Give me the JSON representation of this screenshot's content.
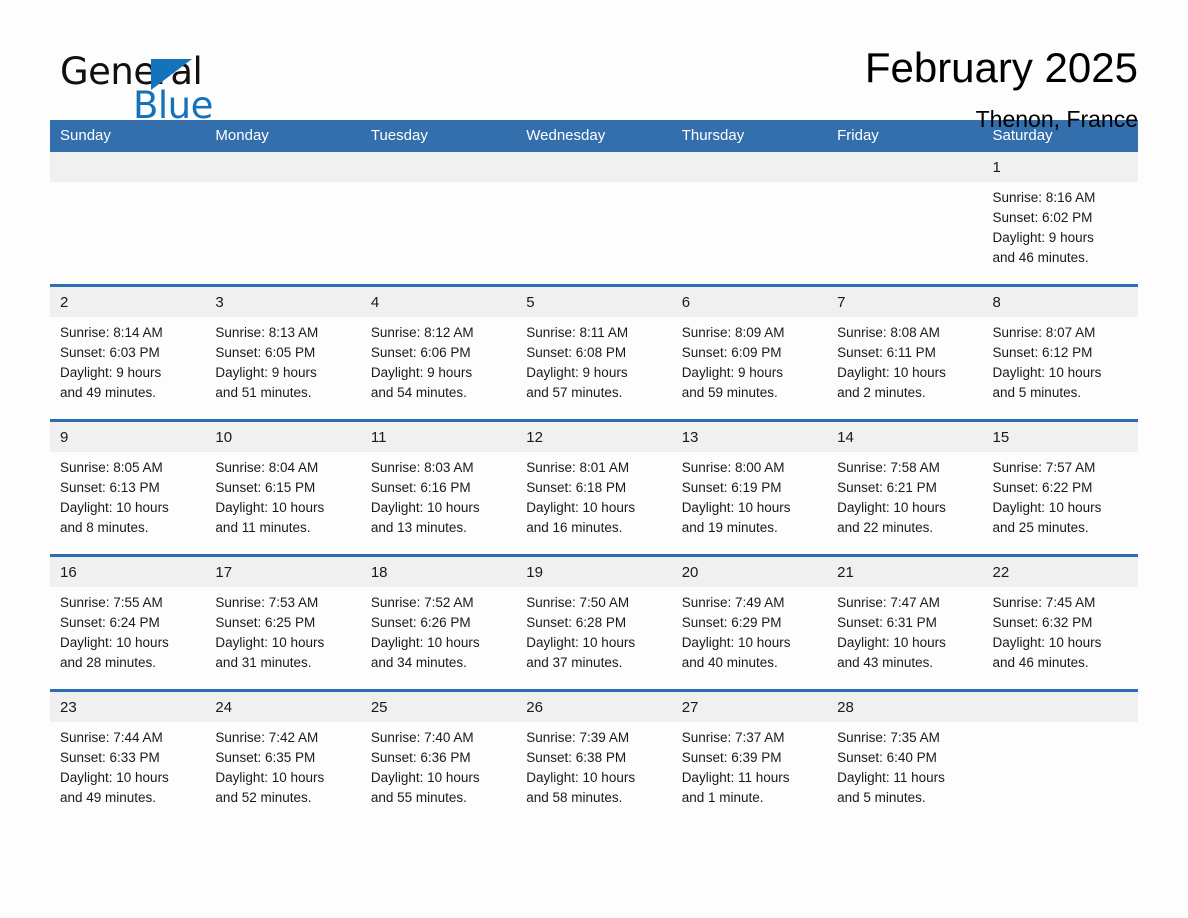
{
  "logo": {
    "word_one": "General",
    "word_two": "Blue",
    "triangle_color": "#1372ba",
    "icon": "triangle-icon"
  },
  "header": {
    "title": "February 2025",
    "location": "Thenon, France"
  },
  "theme": {
    "header_blue": "#336ead",
    "divider_blue": "#2b6cb2",
    "daynum_band": "#f0f0f0",
    "page_background": "#fdfdfd",
    "text": "#1a1a1a"
  },
  "calendar": {
    "weekday_headers": [
      "Sunday",
      "Monday",
      "Tuesday",
      "Wednesday",
      "Thursday",
      "Friday",
      "Saturday"
    ],
    "weeks": [
      [
        {
          "day": "",
          "lines": []
        },
        {
          "day": "",
          "lines": []
        },
        {
          "day": "",
          "lines": []
        },
        {
          "day": "",
          "lines": []
        },
        {
          "day": "",
          "lines": []
        },
        {
          "day": "",
          "lines": []
        },
        {
          "day": "1",
          "lines": [
            "Sunrise: 8:16 AM",
            "Sunset: 6:02 PM",
            "Daylight: 9 hours",
            "and 46 minutes."
          ]
        }
      ],
      [
        {
          "day": "2",
          "lines": [
            "Sunrise: 8:14 AM",
            "Sunset: 6:03 PM",
            "Daylight: 9 hours",
            "and 49 minutes."
          ]
        },
        {
          "day": "3",
          "lines": [
            "Sunrise: 8:13 AM",
            "Sunset: 6:05 PM",
            "Daylight: 9 hours",
            "and 51 minutes."
          ]
        },
        {
          "day": "4",
          "lines": [
            "Sunrise: 8:12 AM",
            "Sunset: 6:06 PM",
            "Daylight: 9 hours",
            "and 54 minutes."
          ]
        },
        {
          "day": "5",
          "lines": [
            "Sunrise: 8:11 AM",
            "Sunset: 6:08 PM",
            "Daylight: 9 hours",
            "and 57 minutes."
          ]
        },
        {
          "day": "6",
          "lines": [
            "Sunrise: 8:09 AM",
            "Sunset: 6:09 PM",
            "Daylight: 9 hours",
            "and 59 minutes."
          ]
        },
        {
          "day": "7",
          "lines": [
            "Sunrise: 8:08 AM",
            "Sunset: 6:11 PM",
            "Daylight: 10 hours",
            "and 2 minutes."
          ]
        },
        {
          "day": "8",
          "lines": [
            "Sunrise: 8:07 AM",
            "Sunset: 6:12 PM",
            "Daylight: 10 hours",
            "and 5 minutes."
          ]
        }
      ],
      [
        {
          "day": "9",
          "lines": [
            "Sunrise: 8:05 AM",
            "Sunset: 6:13 PM",
            "Daylight: 10 hours",
            "and 8 minutes."
          ]
        },
        {
          "day": "10",
          "lines": [
            "Sunrise: 8:04 AM",
            "Sunset: 6:15 PM",
            "Daylight: 10 hours",
            "and 11 minutes."
          ]
        },
        {
          "day": "11",
          "lines": [
            "Sunrise: 8:03 AM",
            "Sunset: 6:16 PM",
            "Daylight: 10 hours",
            "and 13 minutes."
          ]
        },
        {
          "day": "12",
          "lines": [
            "Sunrise: 8:01 AM",
            "Sunset: 6:18 PM",
            "Daylight: 10 hours",
            "and 16 minutes."
          ]
        },
        {
          "day": "13",
          "lines": [
            "Sunrise: 8:00 AM",
            "Sunset: 6:19 PM",
            "Daylight: 10 hours",
            "and 19 minutes."
          ]
        },
        {
          "day": "14",
          "lines": [
            "Sunrise: 7:58 AM",
            "Sunset: 6:21 PM",
            "Daylight: 10 hours",
            "and 22 minutes."
          ]
        },
        {
          "day": "15",
          "lines": [
            "Sunrise: 7:57 AM",
            "Sunset: 6:22 PM",
            "Daylight: 10 hours",
            "and 25 minutes."
          ]
        }
      ],
      [
        {
          "day": "16",
          "lines": [
            "Sunrise: 7:55 AM",
            "Sunset: 6:24 PM",
            "Daylight: 10 hours",
            "and 28 minutes."
          ]
        },
        {
          "day": "17",
          "lines": [
            "Sunrise: 7:53 AM",
            "Sunset: 6:25 PM",
            "Daylight: 10 hours",
            "and 31 minutes."
          ]
        },
        {
          "day": "18",
          "lines": [
            "Sunrise: 7:52 AM",
            "Sunset: 6:26 PM",
            "Daylight: 10 hours",
            "and 34 minutes."
          ]
        },
        {
          "day": "19",
          "lines": [
            "Sunrise: 7:50 AM",
            "Sunset: 6:28 PM",
            "Daylight: 10 hours",
            "and 37 minutes."
          ]
        },
        {
          "day": "20",
          "lines": [
            "Sunrise: 7:49 AM",
            "Sunset: 6:29 PM",
            "Daylight: 10 hours",
            "and 40 minutes."
          ]
        },
        {
          "day": "21",
          "lines": [
            "Sunrise: 7:47 AM",
            "Sunset: 6:31 PM",
            "Daylight: 10 hours",
            "and 43 minutes."
          ]
        },
        {
          "day": "22",
          "lines": [
            "Sunrise: 7:45 AM",
            "Sunset: 6:32 PM",
            "Daylight: 10 hours",
            "and 46 minutes."
          ]
        }
      ],
      [
        {
          "day": "23",
          "lines": [
            "Sunrise: 7:44 AM",
            "Sunset: 6:33 PM",
            "Daylight: 10 hours",
            "and 49 minutes."
          ]
        },
        {
          "day": "24",
          "lines": [
            "Sunrise: 7:42 AM",
            "Sunset: 6:35 PM",
            "Daylight: 10 hours",
            "and 52 minutes."
          ]
        },
        {
          "day": "25",
          "lines": [
            "Sunrise: 7:40 AM",
            "Sunset: 6:36 PM",
            "Daylight: 10 hours",
            "and 55 minutes."
          ]
        },
        {
          "day": "26",
          "lines": [
            "Sunrise: 7:39 AM",
            "Sunset: 6:38 PM",
            "Daylight: 10 hours",
            "and 58 minutes."
          ]
        },
        {
          "day": "27",
          "lines": [
            "Sunrise: 7:37 AM",
            "Sunset: 6:39 PM",
            "Daylight: 11 hours",
            "and 1 minute."
          ]
        },
        {
          "day": "28",
          "lines": [
            "Sunrise: 7:35 AM",
            "Sunset: 6:40 PM",
            "Daylight: 11 hours",
            "and 5 minutes."
          ]
        },
        {
          "day": "",
          "lines": []
        }
      ]
    ]
  }
}
